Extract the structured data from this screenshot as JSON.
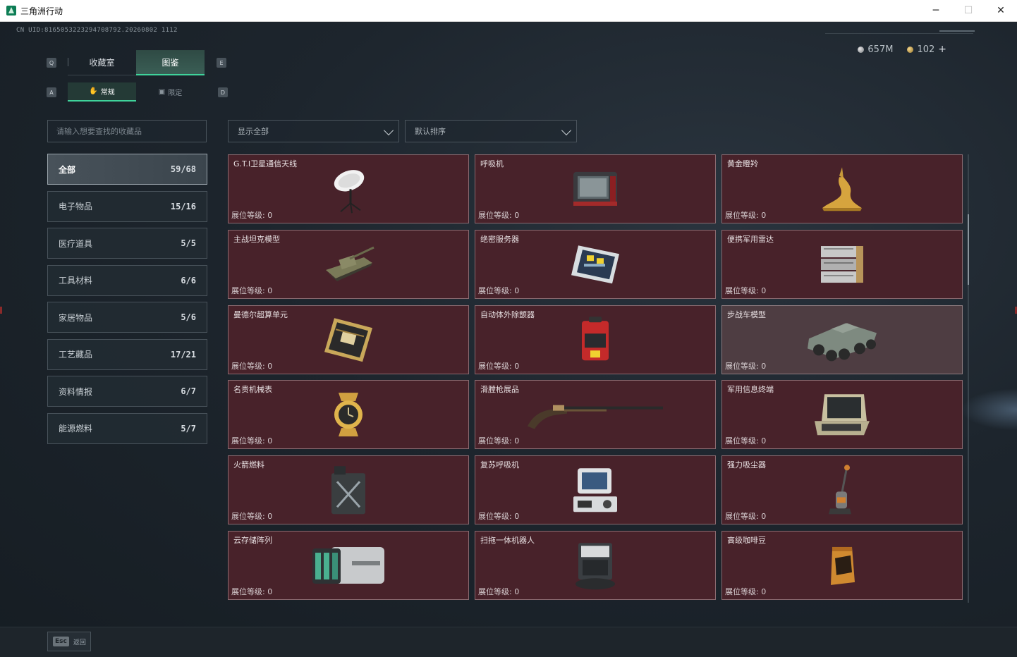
{
  "window": {
    "title": "三角洲行动",
    "minimize": "─",
    "maximize": "☐",
    "close": "✕"
  },
  "header": {
    "uid": "CN UID:8165053223294708792.20260802 1112",
    "currency_silver": "657M",
    "currency_gold": "102",
    "add": "+"
  },
  "keys": {
    "q": "Q",
    "e": "E",
    "a": "A",
    "d": "D"
  },
  "tabs": {
    "main": [
      {
        "label": "收藏室"
      },
      {
        "label": "图鉴"
      }
    ],
    "sub": [
      {
        "label": "常规",
        "icon": "hand-icon"
      },
      {
        "label": "限定",
        "icon": "image-icon"
      }
    ]
  },
  "search": {
    "placeholder": "请输入想要查找的收藏品"
  },
  "filters": {
    "show": "显示全部",
    "sort": "默认排序"
  },
  "categories": [
    {
      "label": "全部",
      "count": "59/68"
    },
    {
      "label": "电子物品",
      "count": "15/16"
    },
    {
      "label": "医疗道具",
      "count": "5/5"
    },
    {
      "label": "工具材料",
      "count": "6/6"
    },
    {
      "label": "家居物品",
      "count": "5/6"
    },
    {
      "label": "工艺藏品",
      "count": "17/21"
    },
    {
      "label": "资料情报",
      "count": "6/7"
    },
    {
      "label": "能源燃料",
      "count": "5/7"
    }
  ],
  "items": [
    {
      "name": "G.T.I卫星通信天线",
      "level": "展位等级: 0",
      "icon": "satellite-dish-icon"
    },
    {
      "name": "呼吸机",
      "level": "展位等级: 0",
      "icon": "ventilator-icon"
    },
    {
      "name": "黄金瞪羚",
      "level": "展位等级: 0",
      "icon": "gold-gazelle-icon"
    },
    {
      "name": "主战坦克模型",
      "level": "展位等级: 0",
      "icon": "tank-model-icon"
    },
    {
      "name": "绝密服务器",
      "level": "展位等级: 0",
      "icon": "server-icon"
    },
    {
      "name": "便携军用雷达",
      "level": "展位等级: 0",
      "icon": "radar-icon"
    },
    {
      "name": "曼德尔超算单元",
      "level": "展位等级: 0",
      "icon": "compute-unit-icon"
    },
    {
      "name": "自动体外除颤器",
      "level": "展位等级: 0",
      "icon": "defibrillator-icon"
    },
    {
      "name": "步战车模型",
      "level": "展位等级: 0",
      "icon": "ifv-model-icon"
    },
    {
      "name": "名贵机械表",
      "level": "展位等级: 0",
      "icon": "watch-icon"
    },
    {
      "name": "滑膛枪展品",
      "level": "展位等级: 0",
      "icon": "musket-icon"
    },
    {
      "name": "军用信息终端",
      "level": "展位等级: 0",
      "icon": "military-terminal-icon"
    },
    {
      "name": "火箭燃料",
      "level": "展位等级: 0",
      "icon": "fuel-can-icon"
    },
    {
      "name": "复苏呼吸机",
      "level": "展位等级: 0",
      "icon": "resuscitator-icon"
    },
    {
      "name": "强力吸尘器",
      "level": "展位等级: 0",
      "icon": "vacuum-icon"
    },
    {
      "name": "云存储阵列",
      "level": "展位等级: 0",
      "icon": "storage-array-icon"
    },
    {
      "name": "扫拖一体机器人",
      "level": "展位等级: 0",
      "icon": "robot-vacuum-icon"
    },
    {
      "name": "高级咖啡豆",
      "level": "展位等级: 0",
      "icon": "coffee-beans-icon"
    }
  ],
  "footer": {
    "esc_key": "Esc",
    "esc_label": "返回"
  }
}
